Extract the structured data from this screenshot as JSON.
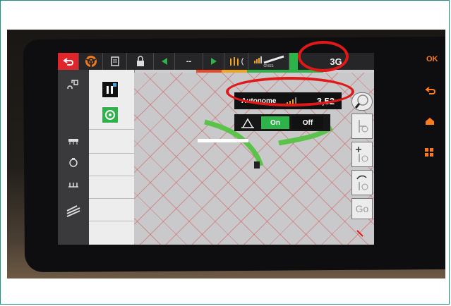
{
  "toolbar": {
    "back_icon": "back-arrow-icon",
    "steering_icon": "steering-wheel-icon",
    "field_value": "--",
    "partial_value": "(",
    "gnss_label": "GNSS",
    "mode_value": "3G"
  },
  "status_bar_colors": [
    "#e84b2a",
    "#f2a31c",
    "#2db34a",
    "#2db34a",
    "#2db34a"
  ],
  "popup": {
    "correction_label": "Autonome",
    "accuracy_value": "3,52",
    "unit_hint": "m"
  },
  "section_control": {
    "on_label": "On",
    "off_label": "Off"
  },
  "right_tools": {
    "go_label": "Go"
  },
  "side_keys": {
    "ok_label": "OK"
  },
  "colors": {
    "accent_green": "#2db34a",
    "highlight_red": "#e01818",
    "key_orange": "#ff7a1a"
  }
}
